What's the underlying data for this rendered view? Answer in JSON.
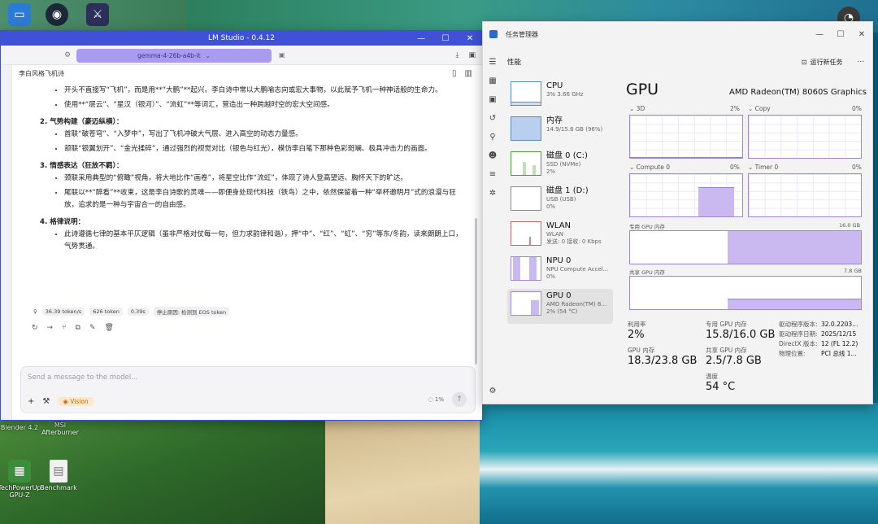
{
  "desktop": {
    "icons": [
      {
        "label": ""
      },
      {
        "label": ""
      },
      {
        "label": ""
      },
      {
        "label": "Blender 4.2"
      },
      {
        "label": "MSI Afterburner"
      },
      {
        "label": "TechPowerUp GPU-Z"
      },
      {
        "label": "Benchmark"
      }
    ]
  },
  "lm": {
    "window_title": "LM Studio - 0.4.12",
    "model": "gemma-4-26b-a4b-it",
    "chat_title": "李白风格飞机诗",
    "intro_bullets": [
      "开头不直接写“飞机”，而是用**“大鹏”**起兴。李白诗中常以大鹏喻志向或宏大事物，以此赋予飞机一种神话般的生命力。",
      "使用**“层云”、“星汉（银河）”、“流虹”**等词汇，营造出一种跨越时空的宏大空间感。"
    ],
    "sections": [
      {
        "title": "2. 气势构建（豪迈纵横）：",
        "bullets": [
          "首联“破苍穹”、“入梦中”，写出了飞机冲破大气层、进入高空的动态力量感。",
          "颔联“银翼划开”、“金光揉碎”，通过强烈的视觉对比（银色与红光），模仿李白笔下那种色彩斑斓、极具冲击力的画面。"
        ]
      },
      {
        "title": "3. 情感表达（狂放不羁）：",
        "bullets": [
          "颈联采用典型的“俯瞰”视角，将大地比作“画卷”，将星空比作“流虹”，体现了诗人登高望远、胸怀天下的旷达。",
          "尾联以**“醉看”**收束，这是李白诗歌的灵魂——即便身处现代科技（铁鸟）之中，依然保留着一种“举杯邀明月”式的浪漫与狂放，追求的是一种与宇宙合一的自由感。"
        ]
      },
      {
        "title": "4. 格律说明：",
        "bullets": [
          "此诗遵循七律的基本平仄逻辑（虽非严格对仗每一句，但力求韵律和谐），押“中”、“红”、“虹”、“穷”等东/冬韵，读来朗朗上口，气势贯通。"
        ]
      }
    ],
    "stats": [
      "36.39 token/s",
      "626 token",
      "0.39s",
      "停止原因: 检测到 EOS token"
    ],
    "composer_placeholder": "Send a message to the model...",
    "vision_label": "Vision",
    "ctx_label": "1%"
  },
  "tm": {
    "window_title": "任务管理器",
    "section": "性能",
    "run_task": "运行新任务",
    "items": [
      {
        "name": "CPU",
        "sub1": "3%  3.66 GHz",
        "sub2": ""
      },
      {
        "name": "内存",
        "sub1": "14.9/15.6 GB (96%)",
        "sub2": ""
      },
      {
        "name": "磁盘 0 (C:)",
        "sub1": "SSD (NVMe)",
        "sub2": "2%"
      },
      {
        "name": "磁盘 1 (D:)",
        "sub1": "USB (USB)",
        "sub2": "0%"
      },
      {
        "name": "WLAN",
        "sub1": "WLAN",
        "sub2": "发送: 0 接收: 0 Kbps"
      },
      {
        "name": "NPU 0",
        "sub1": "NPU Compute Accel...",
        "sub2": "0%"
      },
      {
        "name": "GPU 0",
        "sub1": "AMD Radeon(TM) 8...",
        "sub2": "2% (54 °C)"
      }
    ],
    "gpu": {
      "title": "GPU",
      "model": "AMD Radeon(TM) 8060S Graphics",
      "graphs": [
        {
          "label": "3D",
          "pct": "2%",
          "fill": 0.02
        },
        {
          "label": "Copy",
          "pct": "0%",
          "fill": 0.0
        },
        {
          "label": "Compute 0",
          "pct": "0%",
          "fill": 0.0
        },
        {
          "label": "Timer 0",
          "pct": "0%",
          "fill": 0.0
        }
      ],
      "dedicated_label": "专用 GPU 内存",
      "dedicated_max": "16.0 GB",
      "shared_label": "共享 GPU 内存",
      "shared_max": "7.8 GB",
      "dedicated_usage": 0.99,
      "shared_usage": 0.32
    },
    "stats": {
      "util_k": "利用率",
      "util_v": "2%",
      "ded_k": "专用 GPU 内存",
      "ded_v": "15.8/16.0 GB",
      "gpumem_k": "GPU 内存",
      "gpumem_v": "18.3/23.8 GB",
      "shared_k": "共享 GPU 内存",
      "shared_v": "2.5/7.8 GB",
      "temp_k": "温度",
      "temp_v": "54 °C"
    },
    "driver": [
      {
        "k": "驱动程序版本:",
        "v": "32.0.2203..."
      },
      {
        "k": "驱动程序日期:",
        "v": "2025/12/15"
      },
      {
        "k": "DirectX 版本:",
        "v": "12 (FL 12.2)"
      },
      {
        "k": "物理位置:",
        "v": "PCI 总线 1..."
      }
    ]
  },
  "colors": {
    "lm_accent": "#3f51d6",
    "model_pill": "#a99cf0",
    "gpu_fill": "#cab8f0",
    "gpu_border": "#9e88d4"
  }
}
